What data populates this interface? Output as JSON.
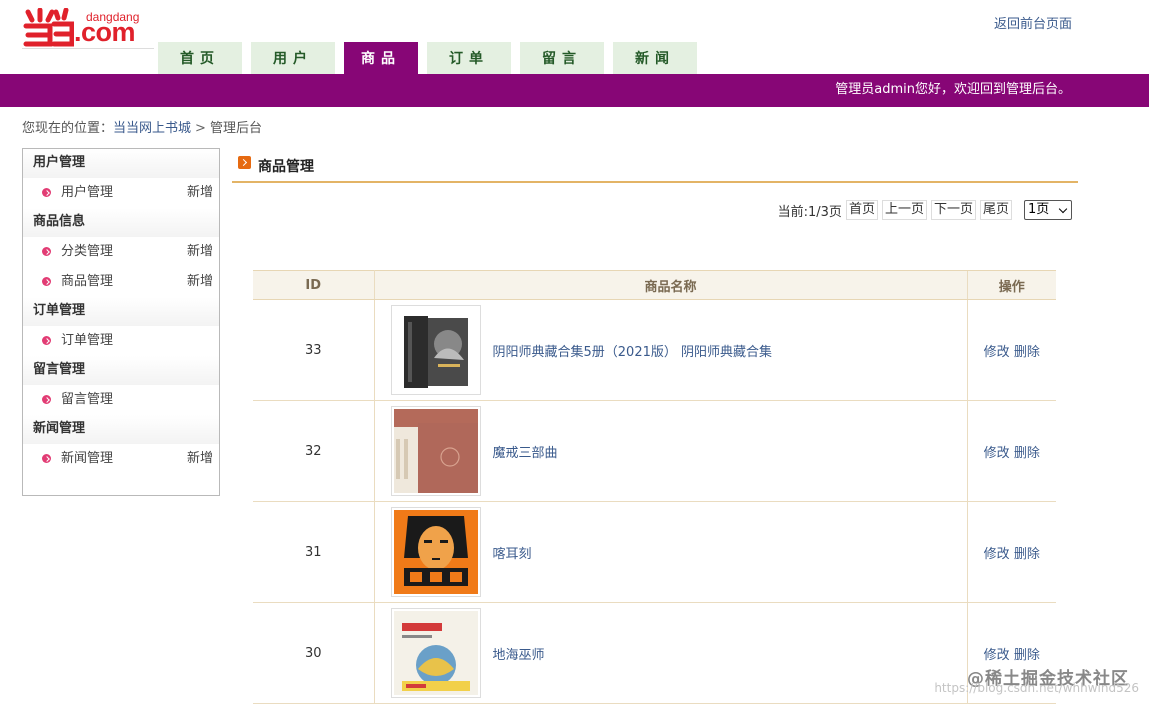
{
  "header": {
    "brand_small": "dangdang",
    "brand_big": ".com",
    "back_link": "返回前台页面",
    "welcome": "管理员admin您好，欢迎回到管理后台。"
  },
  "nav": [
    "首页",
    "用户",
    "商品",
    "订单",
    "留言",
    "新闻"
  ],
  "nav_active": "商品",
  "breadcrumb": {
    "prefix": "您现在的位置：",
    "home": "当当网上书城",
    "sep": ">",
    "current": "管理后台"
  },
  "sidebar": {
    "groups": [
      {
        "title": "用户管理",
        "items": [
          {
            "label": "用户管理",
            "add": "新增"
          }
        ]
      },
      {
        "title": "商品信息",
        "items": [
          {
            "label": "分类管理",
            "add": "新增"
          },
          {
            "label": "商品管理",
            "add": "新增"
          }
        ]
      },
      {
        "title": "订单管理",
        "items": [
          {
            "label": "订单管理",
            "add": ""
          }
        ]
      },
      {
        "title": "留言管理",
        "items": [
          {
            "label": "留言管理",
            "add": ""
          }
        ]
      },
      {
        "title": "新闻管理",
        "items": [
          {
            "label": "新闻管理",
            "add": "新增"
          }
        ]
      }
    ]
  },
  "main": {
    "title": "商品管理"
  },
  "pager": {
    "info": "当前:1/3页",
    "first": "首页",
    "prev": "上一页",
    "next": "下一页",
    "last": "尾页",
    "select": "1页"
  },
  "table": {
    "headers": {
      "id": "ID",
      "name": "商品名称",
      "action": "操作"
    },
    "edit": "修改",
    "delete": "删除",
    "rows": [
      {
        "id": "33",
        "name": "阴阳师典藏合集5册（2021版） 阴阳师典藏合集",
        "cover": "dark-boxset"
      },
      {
        "id": "32",
        "name": "魔戒三部曲",
        "cover": "red-boxset"
      },
      {
        "id": "31",
        "name": "喀耳刻",
        "cover": "orange-face"
      },
      {
        "id": "30",
        "name": "地海巫师",
        "cover": "light-illustrated"
      }
    ]
  },
  "watermark": {
    "text": "@稀土掘金技术社区",
    "url": "https://blog.csdn.net/whhwind526"
  },
  "colors": {
    "accent": "#870676",
    "tab": "#e4f0e1",
    "brand": "#e0212b",
    "link": "#3a5a8c"
  }
}
